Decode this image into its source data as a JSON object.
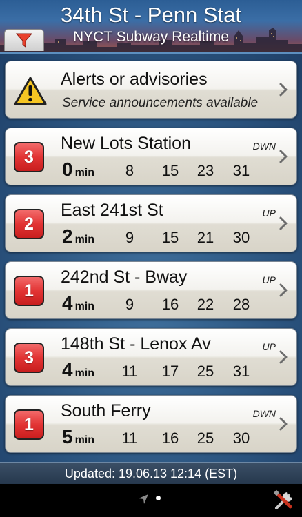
{
  "header": {
    "title": "34th St - Penn Stat",
    "subtitle": "NYCT Subway Realtime",
    "filter_icon": "filter-icon"
  },
  "alerts": {
    "title": "Alerts or advisories",
    "subtitle": "Service announcements available",
    "icon": "warning-icon"
  },
  "trains": [
    {
      "line": "3",
      "destination": "New Lots Station",
      "direction": "DWN",
      "first": "0",
      "unit": "min",
      "times": [
        "8",
        "15",
        "23",
        "31"
      ]
    },
    {
      "line": "2",
      "destination": "East 241st St",
      "direction": "UP",
      "first": "2",
      "unit": "min",
      "times": [
        "9",
        "15",
        "21",
        "30"
      ]
    },
    {
      "line": "1",
      "destination": "242nd St - Bway",
      "direction": "UP",
      "first": "4",
      "unit": "min",
      "times": [
        "9",
        "16",
        "22",
        "28"
      ]
    },
    {
      "line": "3",
      "destination": "148th St - Lenox Av",
      "direction": "UP",
      "first": "4",
      "unit": "min",
      "times": [
        "11",
        "17",
        "25",
        "31"
      ]
    },
    {
      "line": "1",
      "destination": "South Ferry",
      "direction": "DWN",
      "first": "5",
      "unit": "min",
      "times": [
        "11",
        "16",
        "25",
        "30"
      ]
    }
  ],
  "footer": {
    "updated": "Updated: 19.06.13 12:14 (EST)"
  },
  "bottom": {
    "location_icon": "location-arrow-icon",
    "tools_icon": "tools-icon"
  },
  "colors": {
    "badge_red": "#e23434",
    "header_blue": "#2c5e95",
    "background_blue": "#2b547f"
  }
}
